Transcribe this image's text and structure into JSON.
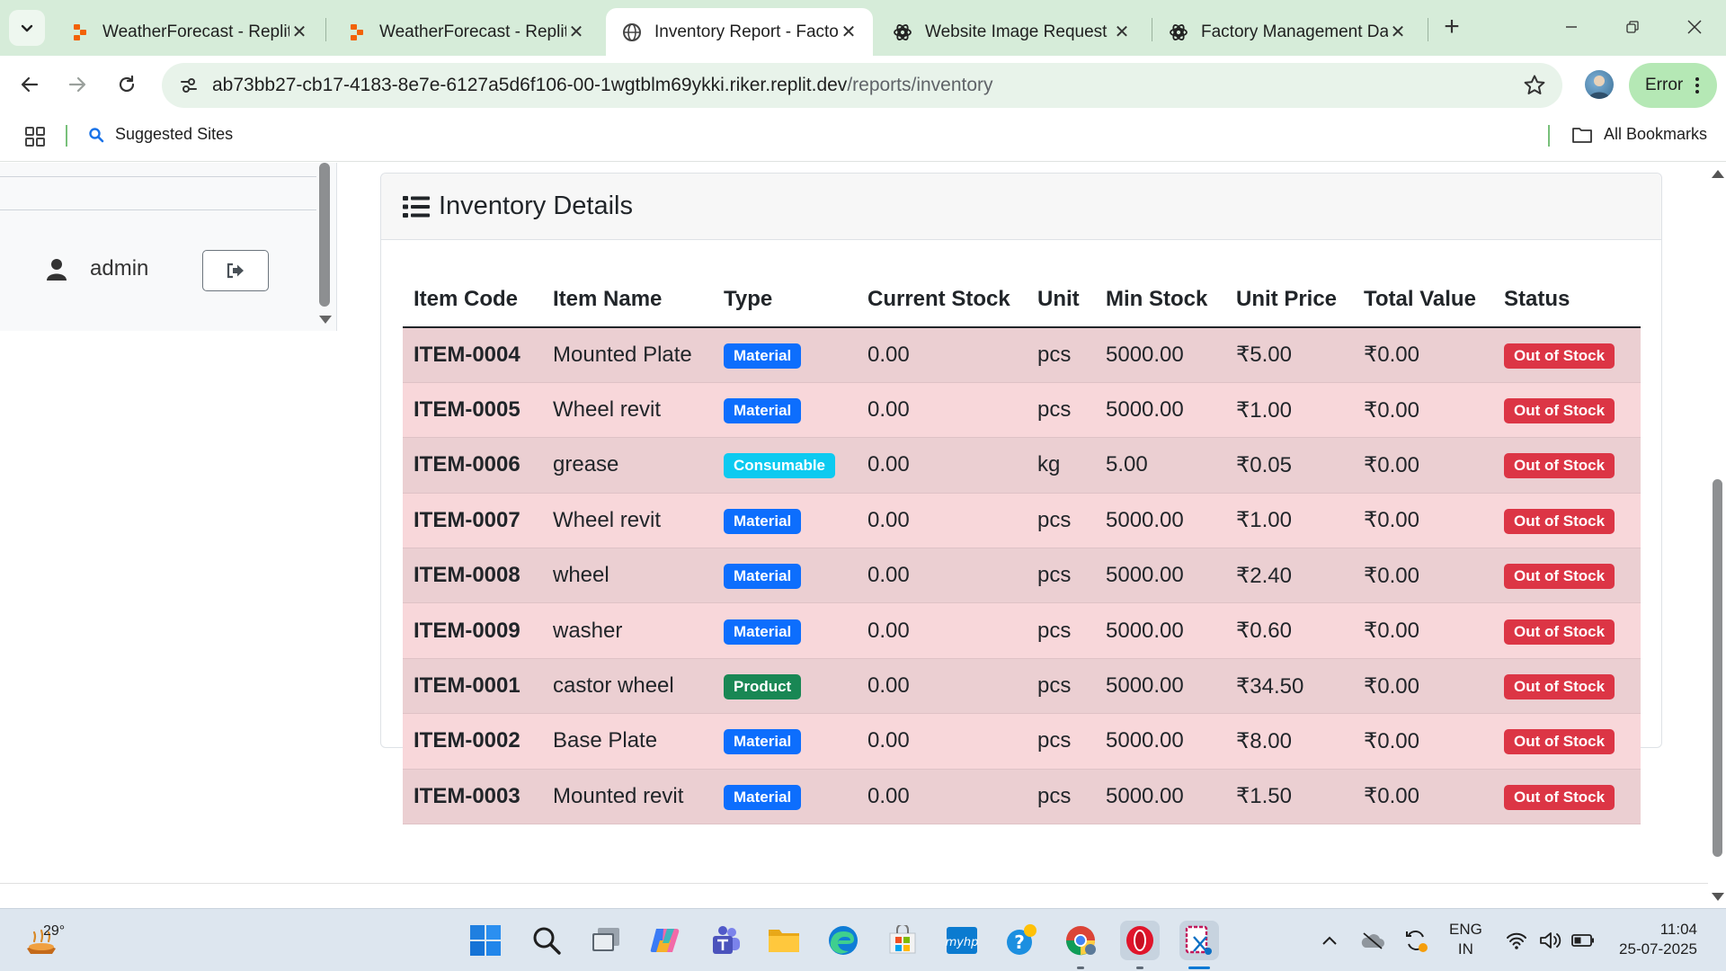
{
  "browser": {
    "tabs": [
      {
        "title": "WeatherForecast - Replit",
        "icon": "replit-icon",
        "active": false
      },
      {
        "title": "WeatherForecast - Replit",
        "icon": "replit-icon",
        "active": false
      },
      {
        "title": "Inventory Report - Factory",
        "icon": "globe-icon",
        "active": true
      },
      {
        "title": "Website Image Request",
        "icon": "openai-icon",
        "active": false
      },
      {
        "title": "Factory Management Dat",
        "icon": "openai-icon",
        "active": false
      }
    ],
    "url_host": "ab73bb27-cb17-4183-8e7e-6127a5d6f106-00-1wgtblm69ykki.riker.replit.dev",
    "url_path": "/reports/inventory",
    "profile_status": "Error",
    "bookmarks": {
      "suggested": "Suggested Sites",
      "all": "All Bookmarks"
    }
  },
  "sidebar": {
    "username": "admin"
  },
  "card": {
    "title": "Inventory Details"
  },
  "table": {
    "headers": [
      "Item Code",
      "Item Name",
      "Type",
      "Current Stock",
      "Unit",
      "Min Stock",
      "Unit Price",
      "Total Value",
      "Status"
    ],
    "rows": [
      {
        "code": "ITEM-0004",
        "name": "Mounted Plate",
        "type": "Material",
        "current": "0.00",
        "unit": "pcs",
        "min": "5000.00",
        "price": "₹5.00",
        "total": "₹0.00",
        "status": "Out of Stock"
      },
      {
        "code": "ITEM-0005",
        "name": "Wheel revit",
        "type": "Material",
        "current": "0.00",
        "unit": "pcs",
        "min": "5000.00",
        "price": "₹1.00",
        "total": "₹0.00",
        "status": "Out of Stock"
      },
      {
        "code": "ITEM-0006",
        "name": "grease",
        "type": "Consumable",
        "current": "0.00",
        "unit": "kg",
        "min": "5.00",
        "price": "₹0.05",
        "total": "₹0.00",
        "status": "Out of Stock"
      },
      {
        "code": "ITEM-0007",
        "name": "Wheel revit",
        "type": "Material",
        "current": "0.00",
        "unit": "pcs",
        "min": "5000.00",
        "price": "₹1.00",
        "total": "₹0.00",
        "status": "Out of Stock"
      },
      {
        "code": "ITEM-0008",
        "name": "wheel",
        "type": "Material",
        "current": "0.00",
        "unit": "pcs",
        "min": "5000.00",
        "price": "₹2.40",
        "total": "₹0.00",
        "status": "Out of Stock"
      },
      {
        "code": "ITEM-0009",
        "name": "washer",
        "type": "Material",
        "current": "0.00",
        "unit": "pcs",
        "min": "5000.00",
        "price": "₹0.60",
        "total": "₹0.00",
        "status": "Out of Stock"
      },
      {
        "code": "ITEM-0001",
        "name": "castor wheel",
        "type": "Product",
        "current": "0.00",
        "unit": "pcs",
        "min": "5000.00",
        "price": "₹34.50",
        "total": "₹0.00",
        "status": "Out of Stock"
      },
      {
        "code": "ITEM-0002",
        "name": "Base Plate",
        "type": "Material",
        "current": "0.00",
        "unit": "pcs",
        "min": "5000.00",
        "price": "₹8.00",
        "total": "₹0.00",
        "status": "Out of Stock"
      },
      {
        "code": "ITEM-0003",
        "name": "Mounted revit",
        "type": "Material",
        "current": "0.00",
        "unit": "pcs",
        "min": "5000.00",
        "price": "₹1.50",
        "total": "₹0.00",
        "status": "Out of Stock"
      }
    ]
  },
  "taskbar": {
    "weather_temp": "29°",
    "language": "ENG",
    "region": "IN",
    "time": "11:04",
    "date": "25-07-2025"
  },
  "colors": {
    "material_badge": "#0d6efd",
    "consumable_badge": "#0dcaf0",
    "product_badge": "#198754",
    "status_badge": "#dc3545",
    "row_danger": "#f8d7da",
    "tabstrip": "#d6ecd9"
  }
}
